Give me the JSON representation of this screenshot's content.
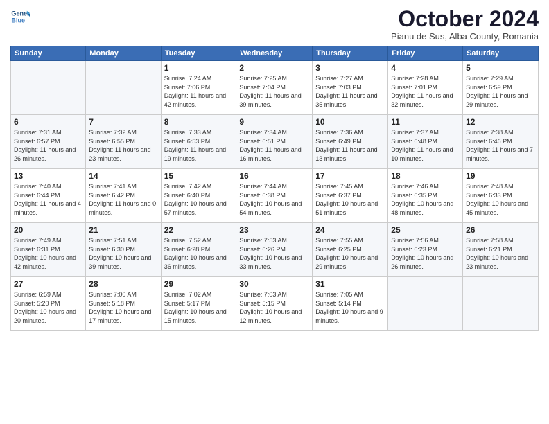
{
  "logo": {
    "line1": "General",
    "line2": "Blue"
  },
  "header": {
    "month": "October 2024",
    "location": "Pianu de Sus, Alba County, Romania"
  },
  "weekdays": [
    "Sunday",
    "Monday",
    "Tuesday",
    "Wednesday",
    "Thursday",
    "Friday",
    "Saturday"
  ],
  "weeks": [
    [
      {
        "day": "",
        "info": ""
      },
      {
        "day": "",
        "info": ""
      },
      {
        "day": "1",
        "info": "Sunrise: 7:24 AM\nSunset: 7:06 PM\nDaylight: 11 hours and 42 minutes."
      },
      {
        "day": "2",
        "info": "Sunrise: 7:25 AM\nSunset: 7:04 PM\nDaylight: 11 hours and 39 minutes."
      },
      {
        "day": "3",
        "info": "Sunrise: 7:27 AM\nSunset: 7:03 PM\nDaylight: 11 hours and 35 minutes."
      },
      {
        "day": "4",
        "info": "Sunrise: 7:28 AM\nSunset: 7:01 PM\nDaylight: 11 hours and 32 minutes."
      },
      {
        "day": "5",
        "info": "Sunrise: 7:29 AM\nSunset: 6:59 PM\nDaylight: 11 hours and 29 minutes."
      }
    ],
    [
      {
        "day": "6",
        "info": "Sunrise: 7:31 AM\nSunset: 6:57 PM\nDaylight: 11 hours and 26 minutes."
      },
      {
        "day": "7",
        "info": "Sunrise: 7:32 AM\nSunset: 6:55 PM\nDaylight: 11 hours and 23 minutes."
      },
      {
        "day": "8",
        "info": "Sunrise: 7:33 AM\nSunset: 6:53 PM\nDaylight: 11 hours and 19 minutes."
      },
      {
        "day": "9",
        "info": "Sunrise: 7:34 AM\nSunset: 6:51 PM\nDaylight: 11 hours and 16 minutes."
      },
      {
        "day": "10",
        "info": "Sunrise: 7:36 AM\nSunset: 6:49 PM\nDaylight: 11 hours and 13 minutes."
      },
      {
        "day": "11",
        "info": "Sunrise: 7:37 AM\nSunset: 6:48 PM\nDaylight: 11 hours and 10 minutes."
      },
      {
        "day": "12",
        "info": "Sunrise: 7:38 AM\nSunset: 6:46 PM\nDaylight: 11 hours and 7 minutes."
      }
    ],
    [
      {
        "day": "13",
        "info": "Sunrise: 7:40 AM\nSunset: 6:44 PM\nDaylight: 11 hours and 4 minutes."
      },
      {
        "day": "14",
        "info": "Sunrise: 7:41 AM\nSunset: 6:42 PM\nDaylight: 11 hours and 0 minutes."
      },
      {
        "day": "15",
        "info": "Sunrise: 7:42 AM\nSunset: 6:40 PM\nDaylight: 10 hours and 57 minutes."
      },
      {
        "day": "16",
        "info": "Sunrise: 7:44 AM\nSunset: 6:38 PM\nDaylight: 10 hours and 54 minutes."
      },
      {
        "day": "17",
        "info": "Sunrise: 7:45 AM\nSunset: 6:37 PM\nDaylight: 10 hours and 51 minutes."
      },
      {
        "day": "18",
        "info": "Sunrise: 7:46 AM\nSunset: 6:35 PM\nDaylight: 10 hours and 48 minutes."
      },
      {
        "day": "19",
        "info": "Sunrise: 7:48 AM\nSunset: 6:33 PM\nDaylight: 10 hours and 45 minutes."
      }
    ],
    [
      {
        "day": "20",
        "info": "Sunrise: 7:49 AM\nSunset: 6:31 PM\nDaylight: 10 hours and 42 minutes."
      },
      {
        "day": "21",
        "info": "Sunrise: 7:51 AM\nSunset: 6:30 PM\nDaylight: 10 hours and 39 minutes."
      },
      {
        "day": "22",
        "info": "Sunrise: 7:52 AM\nSunset: 6:28 PM\nDaylight: 10 hours and 36 minutes."
      },
      {
        "day": "23",
        "info": "Sunrise: 7:53 AM\nSunset: 6:26 PM\nDaylight: 10 hours and 33 minutes."
      },
      {
        "day": "24",
        "info": "Sunrise: 7:55 AM\nSunset: 6:25 PM\nDaylight: 10 hours and 29 minutes."
      },
      {
        "day": "25",
        "info": "Sunrise: 7:56 AM\nSunset: 6:23 PM\nDaylight: 10 hours and 26 minutes."
      },
      {
        "day": "26",
        "info": "Sunrise: 7:58 AM\nSunset: 6:21 PM\nDaylight: 10 hours and 23 minutes."
      }
    ],
    [
      {
        "day": "27",
        "info": "Sunrise: 6:59 AM\nSunset: 5:20 PM\nDaylight: 10 hours and 20 minutes."
      },
      {
        "day": "28",
        "info": "Sunrise: 7:00 AM\nSunset: 5:18 PM\nDaylight: 10 hours and 17 minutes."
      },
      {
        "day": "29",
        "info": "Sunrise: 7:02 AM\nSunset: 5:17 PM\nDaylight: 10 hours and 15 minutes."
      },
      {
        "day": "30",
        "info": "Sunrise: 7:03 AM\nSunset: 5:15 PM\nDaylight: 10 hours and 12 minutes."
      },
      {
        "day": "31",
        "info": "Sunrise: 7:05 AM\nSunset: 5:14 PM\nDaylight: 10 hours and 9 minutes."
      },
      {
        "day": "",
        "info": ""
      },
      {
        "day": "",
        "info": ""
      }
    ]
  ]
}
